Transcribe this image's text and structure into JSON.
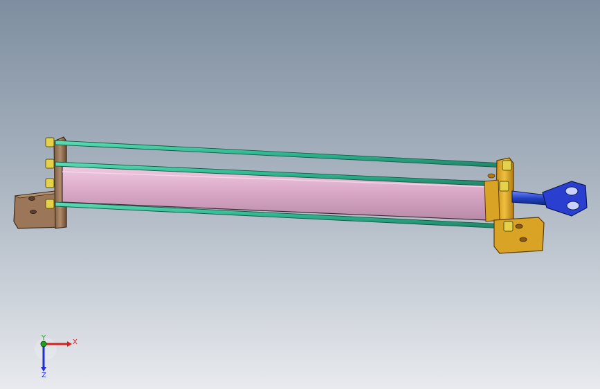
{
  "view": {
    "background_top": "#7e8ea0",
    "background_bottom": "#e8eaee"
  },
  "model": {
    "parts": {
      "barrel_color": "#d8a7c6",
      "tie_rod_color": "#2fb58f",
      "end_cap_left_color": "#a07a5a",
      "end_cap_right_color": "#d9a425",
      "piston_rod_color": "#1f3fbf",
      "clevis_color": "#2a3fd0",
      "nut_color": "#e6d24a"
    }
  },
  "triad": {
    "x_label": "X",
    "y_label": "Y",
    "z_label": "Z",
    "x_color": "#d62020",
    "y_color": "#20a020",
    "z_color": "#2030d0"
  }
}
